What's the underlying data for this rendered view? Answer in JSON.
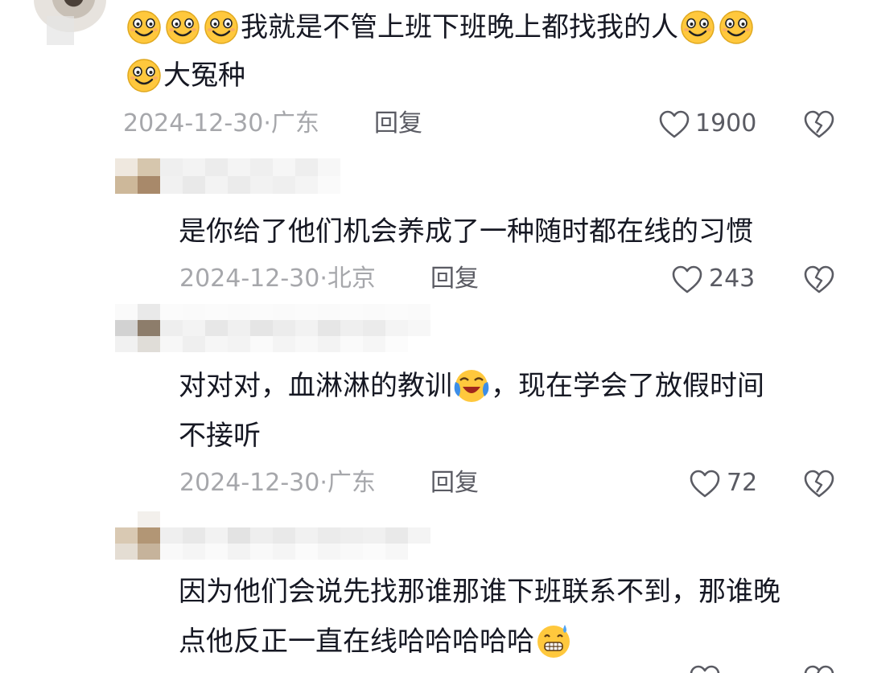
{
  "comments": [
    {
      "text_lines": [
        "我就是不管上班下班晚上都找我的人",
        "大冤种"
      ],
      "date": "2024-12-30",
      "location": "广东",
      "reply_label": "回复",
      "likes": "1900"
    },
    {
      "text_lines": [
        "是你给了他们机会养成了一种随时都在线的习惯"
      ],
      "date": "2024-12-30",
      "location": "北京",
      "reply_label": "回复",
      "likes": "243"
    },
    {
      "text_lines": [
        "对对对，血淋淋的教训",
        "，现在学会了放假时间",
        "不接听"
      ],
      "date": "2024-12-30",
      "location": "广东",
      "reply_label": "回复",
      "likes": "72"
    },
    {
      "text_lines": [
        "因为他们会说先找那谁那谁下班联系不到，那谁晚",
        "点他反正一直在线哈哈哈哈哈"
      ]
    }
  ],
  "separator": "·",
  "icons": {
    "smile": "smile-emoji-icon",
    "cry": "crying-laughing-emoji-icon",
    "sweat": "grin-sweat-emoji-icon",
    "like": "heart-outline-icon",
    "dislike": "broken-heart-icon"
  },
  "colors": {
    "text": "#161823",
    "meta": "#a6a7ab",
    "action": "#5a5b63",
    "emoji": "#ffc83d"
  }
}
